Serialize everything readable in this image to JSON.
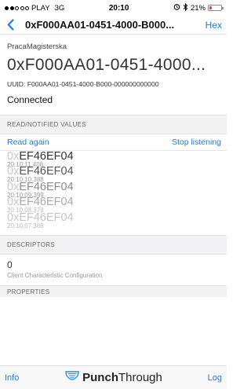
{
  "status_bar": {
    "carrier": "PLAY",
    "network": "3G",
    "time": "20:10",
    "battery_pct": "21%",
    "battery_level": 0.21,
    "battery_color": "#e0443c"
  },
  "nav": {
    "title": "0xF000AA01-0451-4000-B000...",
    "action": "Hex"
  },
  "header": {
    "device_name": "PracaMagisterska",
    "uuid_big": "0xF000AA01-0451-4000...",
    "uuid_full": "UUID: F000AA01-0451-4000-B000-000000000000",
    "status": "Connected"
  },
  "values_section": {
    "title": "READ/NOTIFIED VALUES",
    "read_again": "Read again",
    "stop_listening": "Stop listening",
    "items": [
      {
        "prefix": "0x",
        "hex": "EF46EF04",
        "time": "20:10:11.408"
      },
      {
        "prefix": "0x",
        "hex": "EF46EF04",
        "time": "20:10:10.388"
      },
      {
        "prefix": "0x",
        "hex": "EF46EF04",
        "time": "20:10:09.399"
      },
      {
        "prefix": "0x",
        "hex": "EF46EF04",
        "time": "20:10:08.378"
      },
      {
        "prefix": "0x",
        "hex": "EF46EF04",
        "time": "20:10:07.388"
      }
    ]
  },
  "descriptors_section": {
    "title": "DESCRIPTORS",
    "value": "0",
    "label": "Client Characteristic Configuration"
  },
  "properties_section": {
    "title": "PROPERTIES"
  },
  "tab_bar": {
    "left": "Info",
    "brand_bold": "Punch",
    "brand_regular": "Through",
    "right": "Log"
  },
  "colors": {
    "accent": "#1a7bf2"
  },
  "icons": [
    "back-chevron-icon",
    "alarm-icon",
    "bluetooth-icon",
    "battery-icon",
    "punchthrough-logo-icon"
  ]
}
